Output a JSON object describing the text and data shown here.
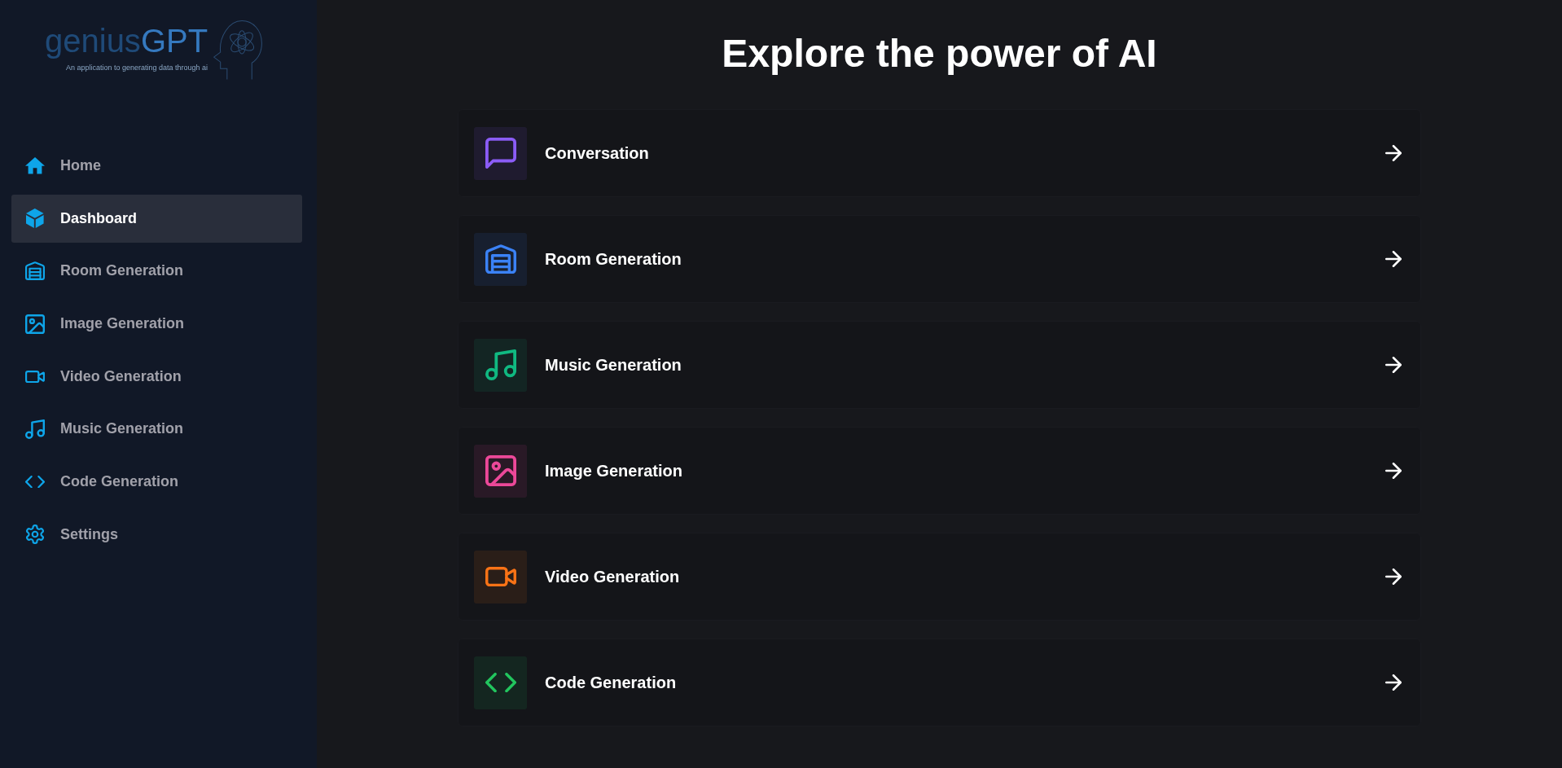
{
  "sidebar": {
    "logo": {
      "wordmark": [
        "genius",
        "GPT"
      ],
      "tagline": "An application to generating data through ai"
    },
    "items": [
      {
        "label": "Home",
        "selected": false
      },
      {
        "label": "Dashboard",
        "selected": true
      },
      {
        "label": "Room Generation",
        "selected": false
      },
      {
        "label": "Image Generation",
        "selected": false
      },
      {
        "label": "Video Generation",
        "selected": false
      },
      {
        "label": "Music Generation",
        "selected": false
      },
      {
        "label": "Code Generation",
        "selected": false
      },
      {
        "label": "Settings",
        "selected": false
      }
    ]
  },
  "main": {
    "title": "Explore the power of AI",
    "cards": [
      {
        "label": "Conversation",
        "color": "#8b5cf6"
      },
      {
        "label": "Room Generation",
        "color": "#3b82f6"
      },
      {
        "label": "Music Generation",
        "color": "#10b981"
      },
      {
        "label": "Image Generation",
        "color": "#ec4899"
      },
      {
        "label": "Video Generation",
        "color": "#f97316"
      },
      {
        "label": "Code Generation",
        "color": "#22c55e"
      }
    ]
  }
}
